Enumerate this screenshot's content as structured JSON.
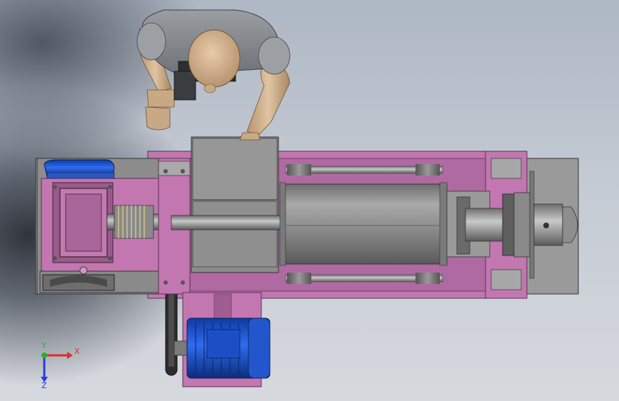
{
  "viewport": {
    "model": "screw-press-assembly",
    "view_orientation": "top"
  },
  "colors": {
    "frame_pink": "#c277b1",
    "frame_pink_dark": "#8e4d80",
    "metal_gray": "#8e8e8e",
    "metal_light": "#b2b2b2",
    "motor_blue": "#1f5bd8",
    "mannequin_skin": "#cfb08e",
    "mannequin_gray": "#8f9398"
  },
  "triad": {
    "x_label": "X",
    "y_label": "Y",
    "z_label": "Z",
    "x_color": "#e02a2a",
    "y_color": "#2ab02a",
    "z_color": "#2a3ae0"
  }
}
